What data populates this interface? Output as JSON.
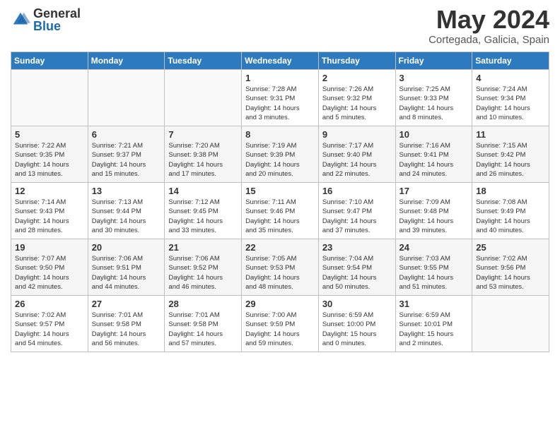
{
  "header": {
    "logo_general": "General",
    "logo_blue": "Blue",
    "month_year": "May 2024",
    "location": "Cortegada, Galicia, Spain"
  },
  "weekdays": [
    "Sunday",
    "Monday",
    "Tuesday",
    "Wednesday",
    "Thursday",
    "Friday",
    "Saturday"
  ],
  "weeks": [
    [
      {
        "day": "",
        "info": ""
      },
      {
        "day": "",
        "info": ""
      },
      {
        "day": "",
        "info": ""
      },
      {
        "day": "1",
        "info": "Sunrise: 7:28 AM\nSunset: 9:31 PM\nDaylight: 14 hours\nand 3 minutes."
      },
      {
        "day": "2",
        "info": "Sunrise: 7:26 AM\nSunset: 9:32 PM\nDaylight: 14 hours\nand 5 minutes."
      },
      {
        "day": "3",
        "info": "Sunrise: 7:25 AM\nSunset: 9:33 PM\nDaylight: 14 hours\nand 8 minutes."
      },
      {
        "day": "4",
        "info": "Sunrise: 7:24 AM\nSunset: 9:34 PM\nDaylight: 14 hours\nand 10 minutes."
      }
    ],
    [
      {
        "day": "5",
        "info": "Sunrise: 7:22 AM\nSunset: 9:35 PM\nDaylight: 14 hours\nand 13 minutes."
      },
      {
        "day": "6",
        "info": "Sunrise: 7:21 AM\nSunset: 9:37 PM\nDaylight: 14 hours\nand 15 minutes."
      },
      {
        "day": "7",
        "info": "Sunrise: 7:20 AM\nSunset: 9:38 PM\nDaylight: 14 hours\nand 17 minutes."
      },
      {
        "day": "8",
        "info": "Sunrise: 7:19 AM\nSunset: 9:39 PM\nDaylight: 14 hours\nand 20 minutes."
      },
      {
        "day": "9",
        "info": "Sunrise: 7:17 AM\nSunset: 9:40 PM\nDaylight: 14 hours\nand 22 minutes."
      },
      {
        "day": "10",
        "info": "Sunrise: 7:16 AM\nSunset: 9:41 PM\nDaylight: 14 hours\nand 24 minutes."
      },
      {
        "day": "11",
        "info": "Sunrise: 7:15 AM\nSunset: 9:42 PM\nDaylight: 14 hours\nand 26 minutes."
      }
    ],
    [
      {
        "day": "12",
        "info": "Sunrise: 7:14 AM\nSunset: 9:43 PM\nDaylight: 14 hours\nand 28 minutes."
      },
      {
        "day": "13",
        "info": "Sunrise: 7:13 AM\nSunset: 9:44 PM\nDaylight: 14 hours\nand 30 minutes."
      },
      {
        "day": "14",
        "info": "Sunrise: 7:12 AM\nSunset: 9:45 PM\nDaylight: 14 hours\nand 33 minutes."
      },
      {
        "day": "15",
        "info": "Sunrise: 7:11 AM\nSunset: 9:46 PM\nDaylight: 14 hours\nand 35 minutes."
      },
      {
        "day": "16",
        "info": "Sunrise: 7:10 AM\nSunset: 9:47 PM\nDaylight: 14 hours\nand 37 minutes."
      },
      {
        "day": "17",
        "info": "Sunrise: 7:09 AM\nSunset: 9:48 PM\nDaylight: 14 hours\nand 39 minutes."
      },
      {
        "day": "18",
        "info": "Sunrise: 7:08 AM\nSunset: 9:49 PM\nDaylight: 14 hours\nand 40 minutes."
      }
    ],
    [
      {
        "day": "19",
        "info": "Sunrise: 7:07 AM\nSunset: 9:50 PM\nDaylight: 14 hours\nand 42 minutes."
      },
      {
        "day": "20",
        "info": "Sunrise: 7:06 AM\nSunset: 9:51 PM\nDaylight: 14 hours\nand 44 minutes."
      },
      {
        "day": "21",
        "info": "Sunrise: 7:06 AM\nSunset: 9:52 PM\nDaylight: 14 hours\nand 46 minutes."
      },
      {
        "day": "22",
        "info": "Sunrise: 7:05 AM\nSunset: 9:53 PM\nDaylight: 14 hours\nand 48 minutes."
      },
      {
        "day": "23",
        "info": "Sunrise: 7:04 AM\nSunset: 9:54 PM\nDaylight: 14 hours\nand 50 minutes."
      },
      {
        "day": "24",
        "info": "Sunrise: 7:03 AM\nSunset: 9:55 PM\nDaylight: 14 hours\nand 51 minutes."
      },
      {
        "day": "25",
        "info": "Sunrise: 7:02 AM\nSunset: 9:56 PM\nDaylight: 14 hours\nand 53 minutes."
      }
    ],
    [
      {
        "day": "26",
        "info": "Sunrise: 7:02 AM\nSunset: 9:57 PM\nDaylight: 14 hours\nand 54 minutes."
      },
      {
        "day": "27",
        "info": "Sunrise: 7:01 AM\nSunset: 9:58 PM\nDaylight: 14 hours\nand 56 minutes."
      },
      {
        "day": "28",
        "info": "Sunrise: 7:01 AM\nSunset: 9:58 PM\nDaylight: 14 hours\nand 57 minutes."
      },
      {
        "day": "29",
        "info": "Sunrise: 7:00 AM\nSunset: 9:59 PM\nDaylight: 14 hours\nand 59 minutes."
      },
      {
        "day": "30",
        "info": "Sunrise: 6:59 AM\nSunset: 10:00 PM\nDaylight: 15 hours\nand 0 minutes."
      },
      {
        "day": "31",
        "info": "Sunrise: 6:59 AM\nSunset: 10:01 PM\nDaylight: 15 hours\nand 2 minutes."
      },
      {
        "day": "",
        "info": ""
      }
    ]
  ]
}
